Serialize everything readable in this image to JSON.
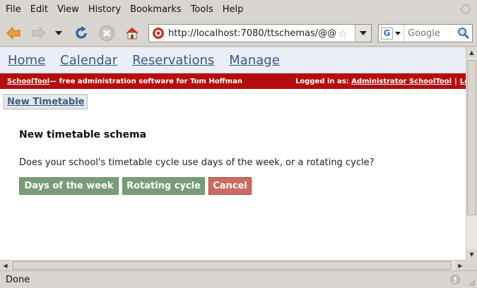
{
  "menubar": {
    "items": [
      "File",
      "Edit",
      "View",
      "History",
      "Bookmarks",
      "Tools",
      "Help"
    ]
  },
  "navbar": {
    "back_icon": "back-arrow-icon",
    "forward_icon": "forward-arrow-icon",
    "history_icon": "history-dropdown-icon",
    "reload_icon": "reload-icon",
    "stop_icon": "stop-icon",
    "home_icon": "home-icon",
    "url": "http://localhost:7080/ttschemas/@@",
    "search_placeholder": "Google",
    "search_engine": "G"
  },
  "page": {
    "sitenav": [
      "Home",
      "Calendar",
      "Reservations",
      "Manage"
    ],
    "banner": {
      "brand": "SchoolTool",
      "tagline": " — free administration software for Tom Hoffman",
      "logged_in_prefix": "Logged in as: ",
      "user": "Administrator SchoolTool",
      "separator": "|",
      "logout_truncated": "Lo"
    },
    "subtab": "New Timetable",
    "heading": "New timetable schema",
    "question": "Does your school's timetable cycle use days of the week, or a rotating cycle?",
    "buttons": {
      "days": "Days of the week",
      "rotating": "Rotating cycle",
      "cancel": "Cancel"
    }
  },
  "statusbar": {
    "text": "Done"
  },
  "colors": {
    "banner_red": "#b50d0d",
    "link_blue": "#3a5a86",
    "button_green": "#789b78",
    "button_red": "#cc6b60"
  }
}
